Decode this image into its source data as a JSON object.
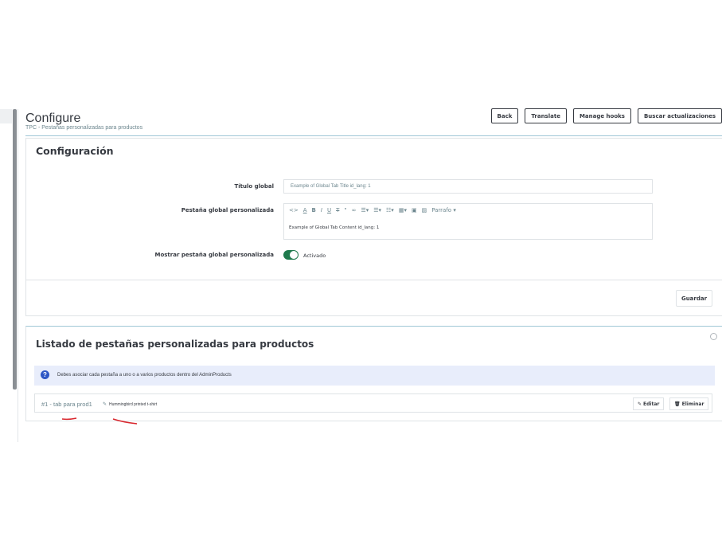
{
  "header": {
    "title": "Configure",
    "subtitle": "TPC - Pestañas personalizadas para productos",
    "buttons": [
      "Back",
      "Translate",
      "Manage hooks",
      "Buscar actualizaciones"
    ]
  },
  "config": {
    "heading": "Configuración",
    "title_label": "Título global",
    "title_value": "Example of Global Tab Title id_lang: 1",
    "tab_label": "Pestaña global personalizada",
    "editor_style": "Parrafo",
    "editor_content": "Example of Global Tab Content id_lang: 1",
    "show_label": "Mostrar pestaña global personalizada",
    "toggle_value": "Activado",
    "save_label": "Guardar"
  },
  "listing": {
    "heading": "Listado de pestañas personalizadas para productos",
    "info_text": "Debes asociar cada pestaña a uno o a varios productos dentro del AdminProducts",
    "row": {
      "name": "#1 - tab para prod1",
      "product": "Hummingbird printed t-shirt",
      "edit_label": "Editar",
      "delete_label": "Eliminar"
    }
  },
  "colors": {
    "toggle": "#1f7a4d",
    "info_bg": "#e8edfb",
    "info_icon": "#2d57c5",
    "annotation": "#d9272e"
  }
}
